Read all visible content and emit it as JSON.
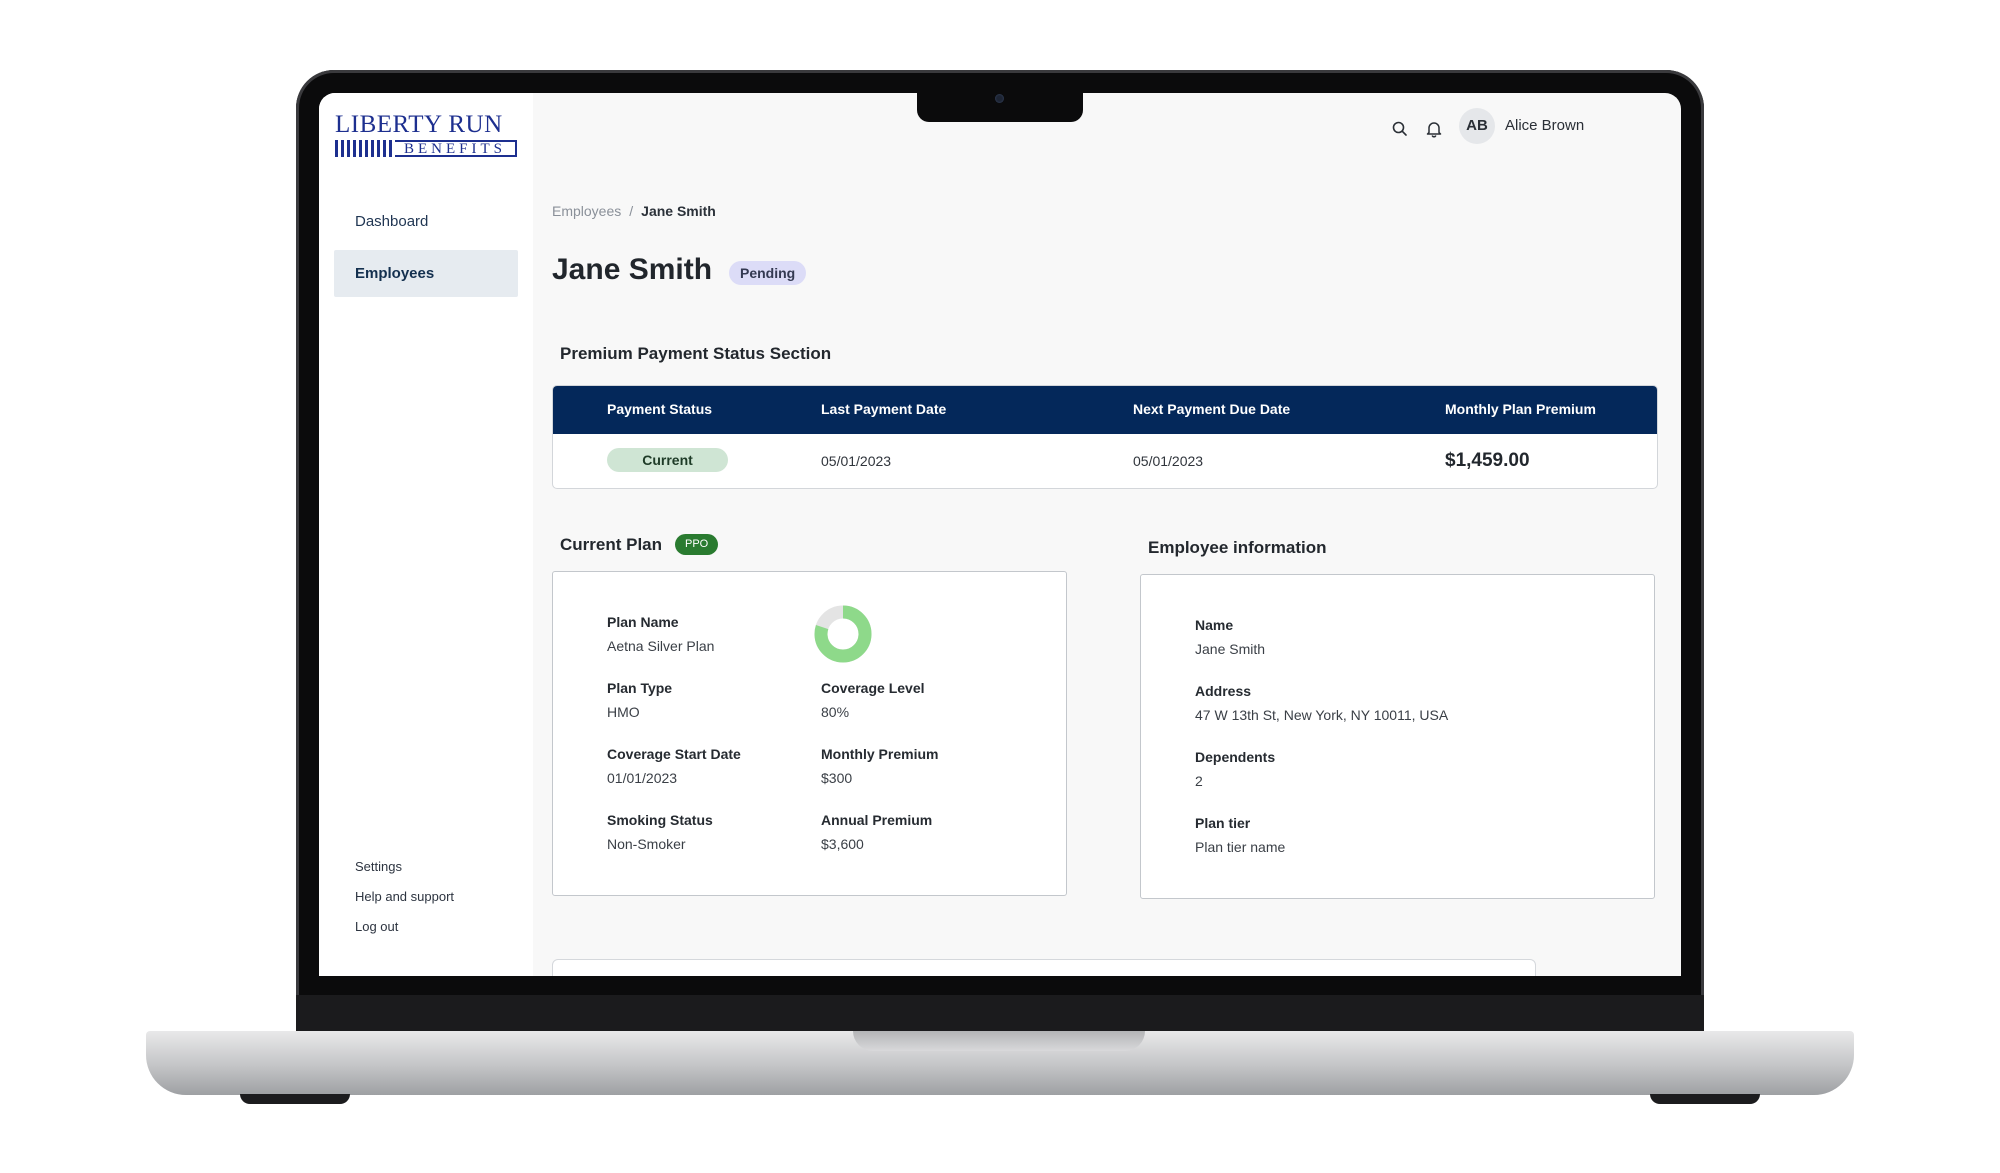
{
  "brand": {
    "logo_top": "LIBERTY RUN",
    "logo_bottom": "BENEFITS"
  },
  "sidebar": {
    "items": [
      {
        "label": "Dashboard"
      },
      {
        "label": "Employees"
      }
    ],
    "footer": [
      {
        "label": "Settings"
      },
      {
        "label": "Help and support"
      },
      {
        "label": "Log out"
      }
    ]
  },
  "topbar": {
    "avatar_initials": "AB",
    "user_name": "Alice Brown",
    "icons": [
      "search-icon",
      "bell-icon"
    ]
  },
  "breadcrumb": {
    "parent": "Employees",
    "separator": "/",
    "current": "Jane Smith"
  },
  "page": {
    "title": "Jane Smith",
    "status_badge": "Pending"
  },
  "payment_section": {
    "title": "Premium Payment Status Section",
    "columns": [
      "Payment Status",
      "Last Payment Date",
      "Next Payment Due Date",
      "Monthly Plan Premium"
    ],
    "row": {
      "status": "Current",
      "last_payment_date": "05/01/2023",
      "next_due_date": "05/01/2023",
      "monthly_premium": "$1,459.00"
    }
  },
  "current_plan": {
    "title": "Current Plan",
    "badge": "PPO",
    "coverage_fraction": 0.8,
    "fields": {
      "plan_name": {
        "label": "Plan Name",
        "value": "Aetna Silver Plan"
      },
      "plan_type": {
        "label": "Plan Type",
        "value": "HMO"
      },
      "coverage_level": {
        "label": "Coverage Level",
        "value": "80%"
      },
      "coverage_start": {
        "label": "Coverage Start Date",
        "value": "01/01/2023"
      },
      "monthly_premium": {
        "label": "Monthly Premium",
        "value": "$300"
      },
      "smoking_status": {
        "label": "Smoking Status",
        "value": "Non-Smoker"
      },
      "annual_premium": {
        "label": "Annual Premium",
        "value": "$3,600"
      }
    }
  },
  "employee_info": {
    "title": "Employee information",
    "fields": {
      "name": {
        "label": "Name",
        "value": "Jane Smith"
      },
      "address": {
        "label": "Address",
        "value": "47 W 13th St, New York, NY 10011, USA"
      },
      "dependents": {
        "label": "Dependents",
        "value": "2"
      },
      "plan_tier": {
        "label": "Plan tier",
        "value": "Plan tier name"
      }
    }
  },
  "colors": {
    "header_navy": "#04285a",
    "active_nav_bg": "#e6ebf0",
    "pending_bg": "#dcdcf7",
    "current_bg": "#cfe5d4",
    "ppo_green": "#2a7b30",
    "donut_fill": "#8ed98a",
    "donut_track": "#e4e4e4",
    "logo_blue": "#1d2f8f"
  }
}
